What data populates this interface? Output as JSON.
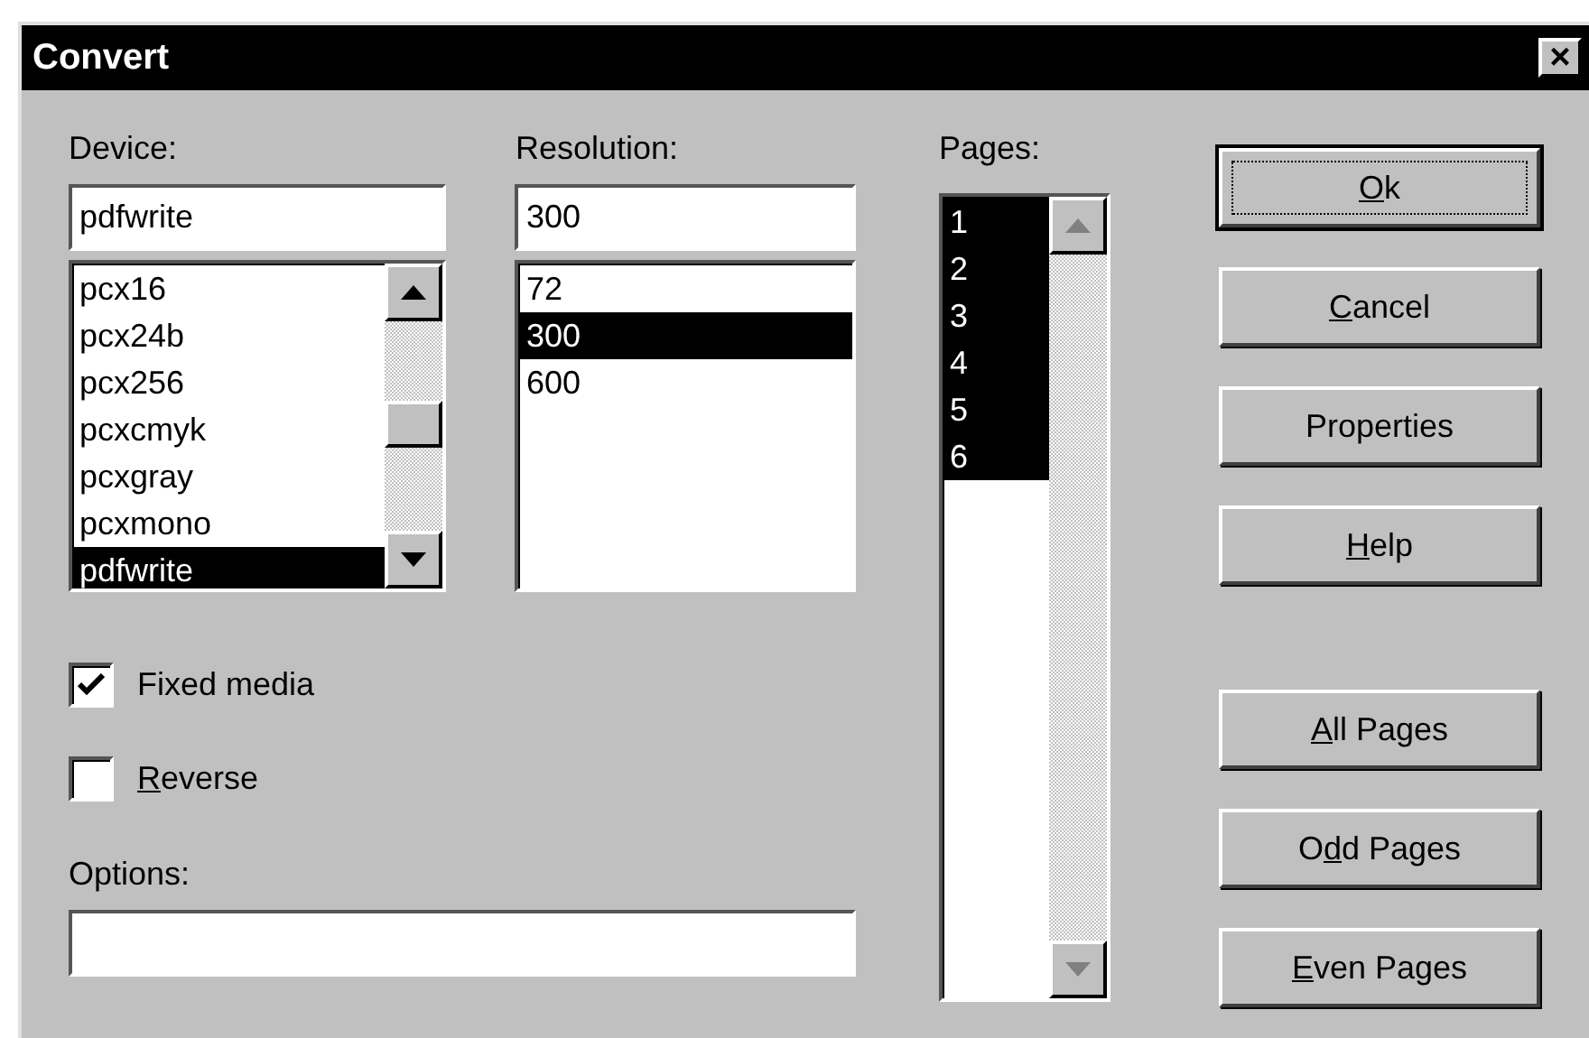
{
  "window": {
    "title": "Convert",
    "close": "×"
  },
  "device": {
    "label": "Device:",
    "value": "pdfwrite",
    "items": [
      {
        "text": "pcx16",
        "selected": false
      },
      {
        "text": "pcx24b",
        "selected": false
      },
      {
        "text": "pcx256",
        "selected": false
      },
      {
        "text": "pcxcmyk",
        "selected": false
      },
      {
        "text": "pcxgray",
        "selected": false
      },
      {
        "text": "pcxmono",
        "selected": false
      },
      {
        "text": "pdfwrite",
        "selected": true
      }
    ]
  },
  "resolution": {
    "label": "Resolution:",
    "value": "300",
    "items": [
      {
        "text": "72",
        "selected": false
      },
      {
        "text": "300",
        "selected": true
      },
      {
        "text": "600",
        "selected": false
      }
    ]
  },
  "pages": {
    "label": "Pages:",
    "items": [
      {
        "text": "1",
        "selected": true
      },
      {
        "text": "2",
        "selected": true
      },
      {
        "text": "3",
        "selected": true
      },
      {
        "text": "4",
        "selected": true
      },
      {
        "text": "5",
        "selected": true
      },
      {
        "text": "6",
        "selected": true
      }
    ]
  },
  "checkboxes": [
    {
      "label": [
        {
          "text": "Fixed media",
          "underlined": false
        }
      ],
      "checked": true
    },
    {
      "label": [
        {
          "text": "R",
          "underlined": true
        },
        {
          "text": "everse",
          "underlined": false
        }
      ],
      "checked": false
    }
  ],
  "options": {
    "label": "Options:"
  },
  "buttons": [
    {
      "label": [
        {
          "text": "O",
          "underlined": true
        },
        {
          "text": "k",
          "underlined": false
        }
      ],
      "default": true
    },
    {
      "label": [
        {
          "text": "C",
          "underlined": true
        },
        {
          "text": "ancel",
          "underlined": false
        }
      ],
      "default": false
    },
    {
      "label": [
        {
          "text": "Properties",
          "underlined": false
        }
      ],
      "default": false
    },
    {
      "label": [
        {
          "text": "H",
          "underlined": true
        },
        {
          "text": "elp",
          "underlined": false
        }
      ],
      "default": false
    }
  ],
  "page_buttons": [
    {
      "label": [
        {
          "text": "A",
          "underlined": true
        },
        {
          "text": "ll Pages",
          "underlined": false
        }
      ],
      "default": false
    },
    {
      "label": [
        {
          "text": "O",
          "underlined": false
        },
        {
          "text": "d",
          "underlined": true
        },
        {
          "text": "d Pages",
          "underlined": false
        }
      ],
      "default": false
    },
    {
      "label": [
        {
          "text": "E",
          "underlined": true
        },
        {
          "text": "ven Pages",
          "underlined": false
        }
      ],
      "default": false
    }
  ]
}
